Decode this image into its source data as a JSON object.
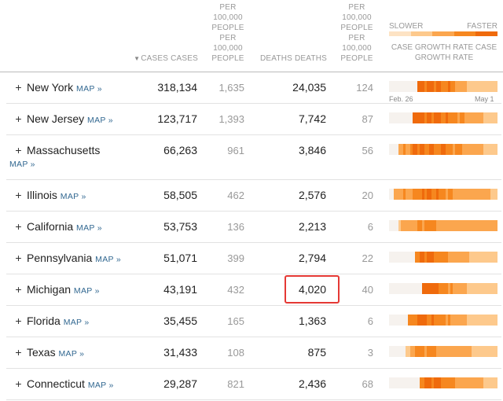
{
  "header": {
    "cases_label": "CASES CASES",
    "sort_indicator": "▼",
    "cases_per_100k": "PER 100,000 PEOPLE PER 100,000 PEOPLE",
    "deaths_label": "DEATHS DEATHS",
    "deaths_per_100k": "PER 100,000 PEOPLE PER 100,000 PEOPLE",
    "legend_slower": "SLOWER",
    "legend_faster": "FASTER",
    "legend_title": "CASE GROWTH RATE CASE GROWTH RATE"
  },
  "axis": {
    "start": "Feb. 26",
    "end": "May 1"
  },
  "colors": {
    "accent_link": "#326891",
    "highlight_border": "#e53935",
    "scale": [
      "#f6f2ee",
      "#fde3c4",
      "#fdc98c",
      "#fba64e",
      "#f6871f",
      "#ef6a0c"
    ]
  },
  "map_label": "MAP »",
  "rows": [
    {
      "state": "New York",
      "cases": "318,134",
      "cases_per_100k": "1,635",
      "deaths": "24,035",
      "deaths_per_100k": "124",
      "growth": [
        0,
        0,
        0,
        0,
        0,
        0,
        0,
        0,
        0,
        0,
        0,
        0,
        5,
        5,
        5,
        4,
        5,
        5,
        5,
        4,
        5,
        5,
        4,
        4,
        4,
        5,
        4,
        4,
        3,
        3,
        3,
        3,
        3,
        2,
        2,
        2,
        2,
        2,
        2,
        2,
        2,
        2,
        2,
        2,
        2,
        2
      ]
    },
    {
      "state": "New Jersey",
      "cases": "123,717",
      "cases_per_100k": "1,393",
      "deaths": "7,742",
      "deaths_per_100k": "87",
      "growth": [
        0,
        0,
        0,
        0,
        0,
        0,
        0,
        0,
        0,
        0,
        5,
        5,
        5,
        5,
        5,
        4,
        5,
        5,
        4,
        5,
        5,
        5,
        4,
        4,
        5,
        4,
        4,
        4,
        4,
        3,
        4,
        4,
        3,
        3,
        3,
        3,
        3,
        3,
        3,
        3,
        2,
        2,
        2,
        2,
        2,
        2
      ]
    },
    {
      "state": "Massachusetts",
      "cases": "66,263",
      "cases_per_100k": "961",
      "deaths": "3,846",
      "deaths_per_100k": "56",
      "growth": [
        0,
        0,
        0,
        0,
        3,
        3,
        4,
        3,
        3,
        4,
        5,
        5,
        4,
        5,
        5,
        4,
        4,
        5,
        5,
        4,
        4,
        4,
        5,
        5,
        4,
        4,
        4,
        3,
        4,
        4,
        4,
        3,
        3,
        3,
        3,
        3,
        3,
        3,
        3,
        3,
        2,
        2,
        2,
        2,
        2,
        2
      ]
    },
    {
      "state": "Illinois",
      "cases": "58,505",
      "cases_per_100k": "462",
      "deaths": "2,576",
      "deaths_per_100k": "20",
      "growth": [
        0,
        0,
        3,
        3,
        3,
        3,
        4,
        3,
        3,
        3,
        4,
        4,
        4,
        4,
        5,
        4,
        5,
        5,
        4,
        4,
        5,
        4,
        4,
        4,
        3,
        4,
        4,
        3,
        3,
        3,
        3,
        3,
        3,
        3,
        3,
        3,
        3,
        3,
        3,
        3,
        3,
        3,
        3,
        2,
        2,
        2
      ]
    },
    {
      "state": "California",
      "cases": "53,753",
      "cases_per_100k": "136",
      "deaths": "2,213",
      "deaths_per_100k": "6",
      "growth": [
        0,
        0,
        0,
        0,
        2,
        3,
        3,
        3,
        3,
        3,
        3,
        3,
        4,
        4,
        3,
        4,
        4,
        4,
        4,
        4,
        3,
        3,
        3,
        3,
        3,
        3,
        3,
        3,
        3,
        3,
        3,
        3,
        3,
        3,
        3,
        3,
        3,
        3,
        3,
        3,
        3,
        3,
        3,
        3,
        3,
        3
      ]
    },
    {
      "state": "Pennsylvania",
      "cases": "51,071",
      "cases_per_100k": "399",
      "deaths": "2,794",
      "deaths_per_100k": "22",
      "growth": [
        0,
        0,
        0,
        0,
        0,
        0,
        0,
        0,
        0,
        0,
        0,
        4,
        4,
        5,
        5,
        4,
        5,
        5,
        5,
        4,
        4,
        4,
        4,
        4,
        4,
        3,
        3,
        3,
        3,
        3,
        3,
        3,
        3,
        3,
        2,
        2,
        2,
        2,
        2,
        2,
        2,
        2,
        2,
        2,
        2,
        2
      ]
    },
    {
      "state": "Michigan",
      "cases": "43,191",
      "cases_per_100k": "432",
      "deaths": "4,020",
      "deaths_per_100k": "40",
      "highlight": true,
      "growth": [
        0,
        0,
        0,
        0,
        0,
        0,
        0,
        0,
        0,
        0,
        0,
        0,
        0,
        0,
        5,
        5,
        5,
        5,
        5,
        5,
        5,
        4,
        4,
        4,
        4,
        3,
        4,
        3,
        3,
        3,
        3,
        3,
        3,
        2,
        2,
        2,
        2,
        2,
        2,
        2,
        2,
        2,
        2,
        2,
        2,
        2
      ]
    },
    {
      "state": "Florida",
      "cases": "35,455",
      "cases_per_100k": "165",
      "deaths": "1,363",
      "deaths_per_100k": "6",
      "growth": [
        0,
        0,
        0,
        0,
        0,
        0,
        0,
        0,
        4,
        4,
        4,
        4,
        5,
        5,
        5,
        5,
        4,
        4,
        5,
        4,
        4,
        4,
        4,
        4,
        3,
        4,
        3,
        3,
        3,
        3,
        3,
        3,
        3,
        2,
        2,
        2,
        2,
        2,
        2,
        2,
        2,
        2,
        2,
        2,
        2,
        2
      ]
    },
    {
      "state": "Texas",
      "cases": "31,433",
      "cases_per_100k": "108",
      "deaths": "875",
      "deaths_per_100k": "3",
      "growth": [
        0,
        0,
        0,
        0,
        0,
        0,
        0,
        2,
        2,
        3,
        3,
        4,
        4,
        4,
        4,
        3,
        4,
        4,
        4,
        4,
        3,
        3,
        3,
        3,
        3,
        3,
        3,
        3,
        3,
        3,
        3,
        3,
        3,
        3,
        3,
        2,
        2,
        2,
        2,
        2,
        2,
        2,
        2,
        2,
        2,
        2
      ]
    },
    {
      "state": "Connecticut",
      "cases": "29,287",
      "cases_per_100k": "821",
      "deaths": "2,436",
      "deaths_per_100k": "68",
      "growth": [
        0,
        0,
        0,
        0,
        0,
        0,
        0,
        0,
        0,
        0,
        0,
        0,
        0,
        4,
        4,
        5,
        5,
        5,
        4,
        5,
        5,
        5,
        4,
        4,
        4,
        4,
        4,
        4,
        3,
        3,
        3,
        3,
        3,
        3,
        3,
        3,
        3,
        3,
        3,
        3,
        2,
        2,
        2,
        2,
        2,
        2
      ]
    }
  ]
}
